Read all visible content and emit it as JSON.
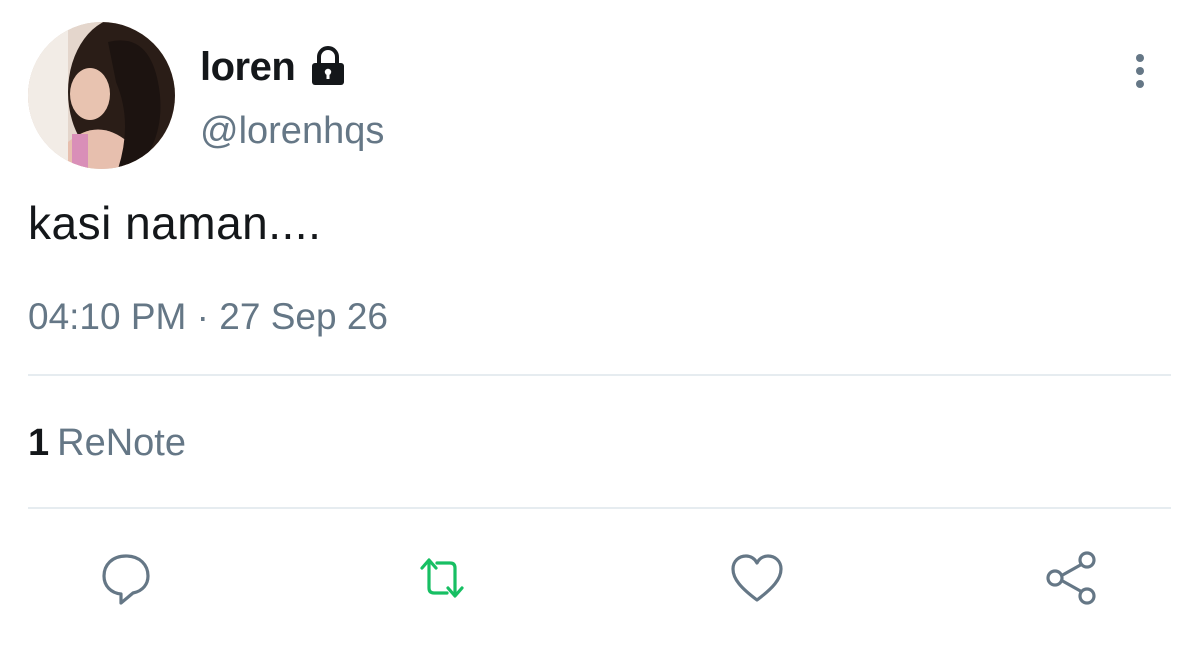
{
  "user": {
    "display_name": "loren",
    "handle": "@lorenhqs",
    "protected": true
  },
  "post": {
    "text": "kasi naman....",
    "time": "04:10 PM",
    "separator": " · ",
    "date": "27 Sep 26"
  },
  "stats": {
    "renote_count": "1",
    "renote_label": "ReNote"
  },
  "icons": {
    "lock": "lock-icon",
    "more": "vertical-dots-icon",
    "reply": "speech-bubble-icon",
    "renote": "repeat-arrows-icon",
    "like": "heart-icon",
    "share": "share-nodes-icon"
  },
  "colors": {
    "text_primary": "#14171a",
    "text_secondary": "#657786",
    "renote_active": "#17bf63",
    "icon_gray": "#657786",
    "divider": "#e6ecf0"
  }
}
